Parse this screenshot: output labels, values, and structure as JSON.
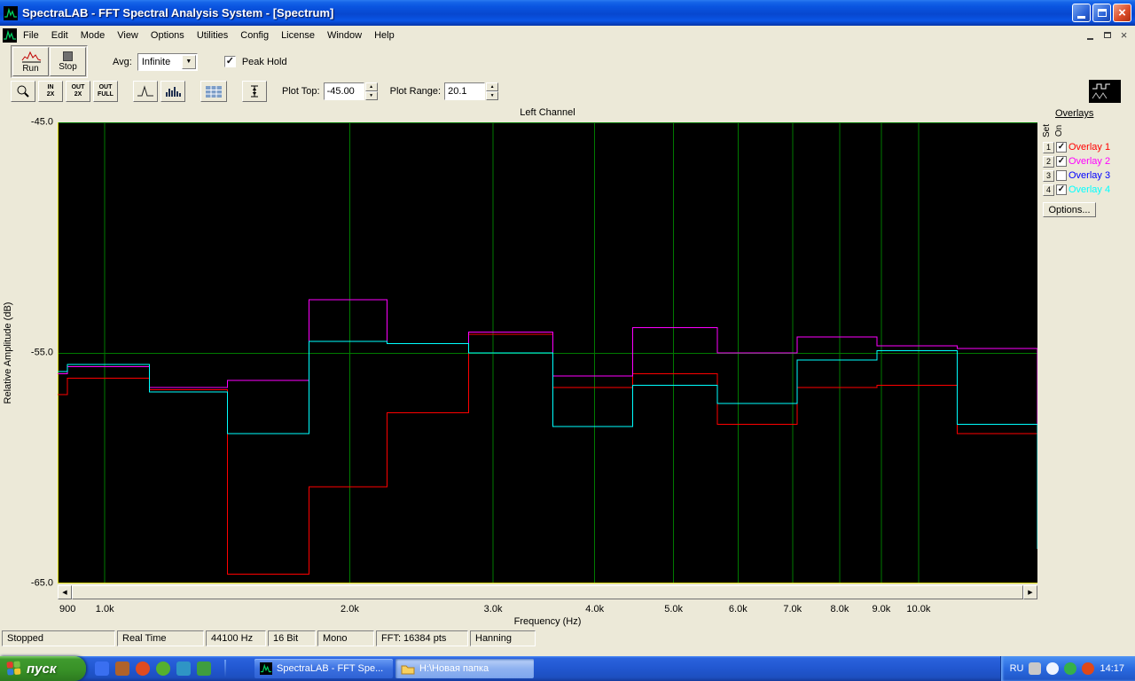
{
  "window": {
    "title": "SpectraLAB - FFT Spectral Analysis System - [Spectrum]"
  },
  "menubar": {
    "items": [
      "File",
      "Edit",
      "Mode",
      "View",
      "Options",
      "Utilities",
      "Config",
      "License",
      "Window",
      "Help"
    ]
  },
  "toolbar1": {
    "run_label": "Run",
    "stop_label": "Stop",
    "avg_label": "Avg:",
    "avg_value": "Infinite",
    "peak_hold_label": "Peak Hold",
    "peak_hold_checked": true
  },
  "toolbar2": {
    "zoom_in_line1": "IN",
    "zoom_in_line2": "2X",
    "zoom_out_line1": "OUT",
    "zoom_out_line2": "2X",
    "zoom_full_line1": "OUT",
    "zoom_full_line2": "FULL",
    "plot_top_label": "Plot Top:",
    "plot_top_value": "-45.00",
    "plot_range_label": "Plot Range:",
    "plot_range_value": "20.1"
  },
  "plot": {
    "title": "Left Channel",
    "ylabel": "Relative Amplitude (dB)",
    "xlabel": "Frequency (Hz)"
  },
  "overlays": {
    "heading": "Overlays",
    "set_label": "Set",
    "on_label": "On",
    "options_label": "Options...",
    "items": [
      {
        "num": "1",
        "label": "Overlay 1",
        "color": "#ff0000",
        "checked": true
      },
      {
        "num": "2",
        "label": "Overlay 2",
        "color": "#ff00ff",
        "checked": true
      },
      {
        "num": "3",
        "label": "Overlay 3",
        "color": "#0000ff",
        "checked": false
      },
      {
        "num": "4",
        "label": "Overlay 4",
        "color": "#00ffff",
        "checked": true
      }
    ]
  },
  "statusbar": {
    "fields": [
      "Stopped",
      "Real Time",
      "44100 Hz",
      "16 Bit",
      "Mono",
      "FFT: 16384 pts",
      "Hanning"
    ]
  },
  "taskbar": {
    "start_label": "пуск",
    "tasks": [
      {
        "label": "SpectraLAB - FFT Spe...",
        "active": false
      },
      {
        "label": "H:\\Новая папка",
        "active": true
      }
    ],
    "tray": {
      "lang": "RU",
      "clock": "14:17"
    }
  },
  "chart_data": {
    "type": "line",
    "title": "Left Channel",
    "xlabel": "Frequency (Hz)",
    "ylabel": "Relative Amplitude (dB)",
    "x_scale": "log",
    "x_range_hz": [
      875,
      14000
    ],
    "y_range_db": [
      -65,
      -45
    ],
    "grid_color": "#007a00",
    "axis_color": "#d8d800",
    "background": "#000000",
    "yticks": [
      {
        "db": -45,
        "label": "-45.0"
      },
      {
        "db": -55,
        "label": "-55.0"
      },
      {
        "db": -65,
        "label": "-65.0"
      }
    ],
    "xticks": [
      {
        "hz": 900,
        "label": "900"
      },
      {
        "hz": 1000,
        "label": "1.0k"
      },
      {
        "hz": 2000,
        "label": "2.0k"
      },
      {
        "hz": 3000,
        "label": "3.0k"
      },
      {
        "hz": 4000,
        "label": "4.0k"
      },
      {
        "hz": 5000,
        "label": "5.0k"
      },
      {
        "hz": 6000,
        "label": "6.0k"
      },
      {
        "hz": 7000,
        "label": "7.0k"
      },
      {
        "hz": 8000,
        "label": "8.0k"
      },
      {
        "hz": 9000,
        "label": "9.0k"
      },
      {
        "hz": 10000,
        "label": "10.0k"
      }
    ],
    "grid": {
      "v_hz": [
        1000,
        2000,
        3000,
        4000,
        5000,
        6000,
        7000,
        8000,
        9000,
        10000
      ],
      "h_db": [
        -45,
        -55
      ]
    },
    "band_edges_hz": [
      875,
      900,
      1134,
      1414,
      1782,
      2222,
      2798,
      3552,
      4452,
      5657,
      7096,
      8892,
      11150,
      14000
    ],
    "series": [
      {
        "name": "Overlay 1",
        "color": "#ff0000",
        "values_db": [
          -56.8,
          -56.1,
          -56.6,
          -64.6,
          -60.8,
          -57.6,
          -54.2,
          -56.5,
          -55.9,
          -58.1,
          -56.5,
          -56.4,
          -58.5
        ],
        "end_drop_db": null
      },
      {
        "name": "Overlay 2",
        "color": "#ff00ff",
        "values_db": [
          -55.9,
          -55.6,
          -56.5,
          -56.2,
          -52.7,
          -54.6,
          -54.1,
          -56.0,
          -53.9,
          -55.0,
          -54.3,
          -54.7,
          -54.8
        ],
        "end_drop_db": -63.2
      },
      {
        "name": "Overlay 4",
        "color": "#00ffff",
        "values_db": [
          -55.8,
          -55.5,
          -56.7,
          -58.5,
          -54.5,
          -54.6,
          -55.0,
          -58.2,
          -56.4,
          -57.2,
          -55.3,
          -54.9,
          -58.1
        ],
        "end_drop_db": -63.5
      }
    ]
  }
}
